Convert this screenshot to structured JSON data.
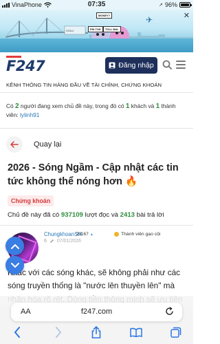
{
  "status_bar": {
    "carrier": "VinaPhone",
    "time": "07:35",
    "battery_percent": "96%",
    "battery_level": 0.96
  },
  "banner": {
    "signs": [
      "MONEY?",
      "FIN TOK",
      "TOLL BAL",
      "VOLU"
    ],
    "close_icon": "close-icon"
  },
  "header": {
    "logo": "F247",
    "login_label": "Đăng nhập",
    "tagline": "KÊNH THÔNG TIN HÀNG ĐẦU VỀ TÀI CHÍNH, CHỨNG KHOÁN"
  },
  "viewing": {
    "prefix": "Có ",
    "count": "2",
    "mid1": " người đang xem chủ đề này, trong đó có ",
    "guests": "1",
    "mid2": " khách và ",
    "members": "1",
    "mid3": " thành viên: ",
    "user": "lylinh91"
  },
  "back_label": "Quay lại",
  "topic": {
    "title": "2026 - Sóng Ngầm - Cập nhật các tin tức không thể nóng hơn",
    "category": "Chứng khoán",
    "stats_prefix": "Chủ đề này đã có ",
    "reads": "937109",
    "stats_mid": " lượt đọc và ",
    "replies": "2413",
    "stats_suffix": " bài trả lời"
  },
  "post": {
    "author": "ChungkhoanSH",
    "reputation": "21167",
    "member_title": "Thành viên gạo cội",
    "edit_count": "6",
    "date": "07/01/2026",
    "body": "Khác với các sóng khác, sẽ không phải như các sóng truyền thống là \"nước lên thuyền lên\" mà nhận hóa rõ rệt. Dòng tiền thông minh sẽ ưu tiên"
  },
  "browser": {
    "aa_label": "AA",
    "url": "f247.com"
  }
}
